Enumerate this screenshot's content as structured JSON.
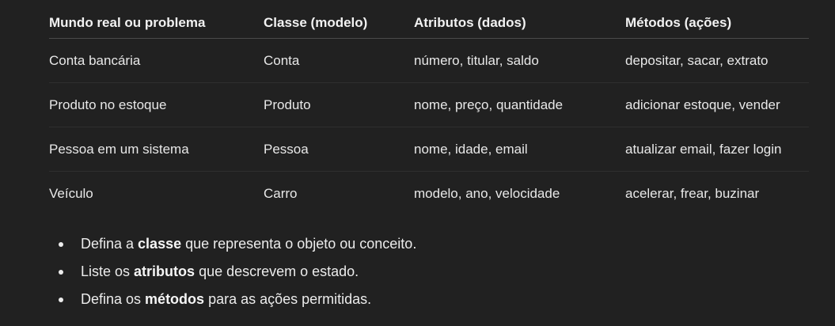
{
  "table": {
    "headers": [
      "Mundo real ou problema",
      "Classe (modelo)",
      "Atributos (dados)",
      "Métodos (ações)"
    ],
    "rows": [
      [
        "Conta bancária",
        "Conta",
        "número, titular, saldo",
        "depositar, sacar, extrato"
      ],
      [
        "Produto no estoque",
        "Produto",
        "nome, preço, quantidade",
        "adicionar estoque, vender"
      ],
      [
        "Pessoa em um sistema",
        "Pessoa",
        "nome, idade, email",
        "atualizar email, fazer login"
      ],
      [
        "Veículo",
        "Carro",
        "modelo, ano, velocidade",
        "acelerar, frear, buzinar"
      ]
    ]
  },
  "tips": [
    {
      "before": "Defina a ",
      "bold": "classe",
      "after": " que representa o objeto ou conceito."
    },
    {
      "before": "Liste os ",
      "bold": "atributos",
      "after": " que descrevem o estado."
    },
    {
      "before": "Defina os ",
      "bold": "métodos",
      "after": " para as ações permitidas."
    }
  ]
}
